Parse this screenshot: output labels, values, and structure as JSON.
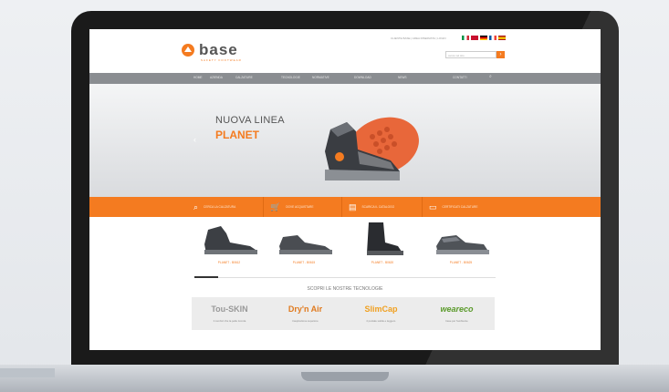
{
  "site": {
    "logo_text": "base",
    "logo_sub": "PROTECTION",
    "tagline": "SAFETY FOOTWEAR",
    "utility_links": "CLIENTE BASE | AREA RISERVATA | LOGIN",
    "search_placeholder": "cerca nel sito",
    "flags": [
      "#c8102e",
      "#ffffff",
      "#000000",
      "#dd0000",
      "#009246"
    ]
  },
  "nav": {
    "items": [
      "HOME",
      "AZIENDA",
      "CALZATURE",
      "TECNOLOGIE",
      "NORMATIVE",
      "DOWNLOAD",
      "NEWS",
      "CONTATTI"
    ],
    "search_icon": "search-icon"
  },
  "hero": {
    "title": "NUOVA LINEA",
    "subtitle": "PLANET"
  },
  "orange_bar": [
    {
      "icon": "search-icon",
      "label": "CERCA LA CALZATURA"
    },
    {
      "icon": "cart-icon",
      "label": "DOVE ACQUISTARE"
    },
    {
      "icon": "catalog-icon",
      "label": "SCARICA IL CATALOGO"
    },
    {
      "icon": "folder-icon",
      "label": "CERTIFICATI CALZATURE"
    }
  ],
  "products": [
    {
      "label": "PLANET - B0612"
    },
    {
      "label": "PLANET - B0615"
    },
    {
      "label": "PLANET - B0620"
    },
    {
      "label": "PLANET - B0625"
    }
  ],
  "technologies": {
    "title": "SCOPRI LE NOSTRE TECNOLOGIE",
    "items": [
      {
        "name": "Tou-SKIN",
        "desc": "il comfort che la pelle ricorda",
        "color": "#999999"
      },
      {
        "name": "Dry'n Air",
        "desc": "traspirazione superiore",
        "color": "#e07a1e"
      },
      {
        "name": "SlimCap",
        "desc": "il puntale sottile e leggero",
        "color": "#f0a020"
      },
      {
        "name": "weareco",
        "desc": "base per l'ambiente",
        "color": "#5a9a2a"
      }
    ]
  },
  "colors": {
    "accent": "#f47b20",
    "nav": "#8a8d91"
  }
}
